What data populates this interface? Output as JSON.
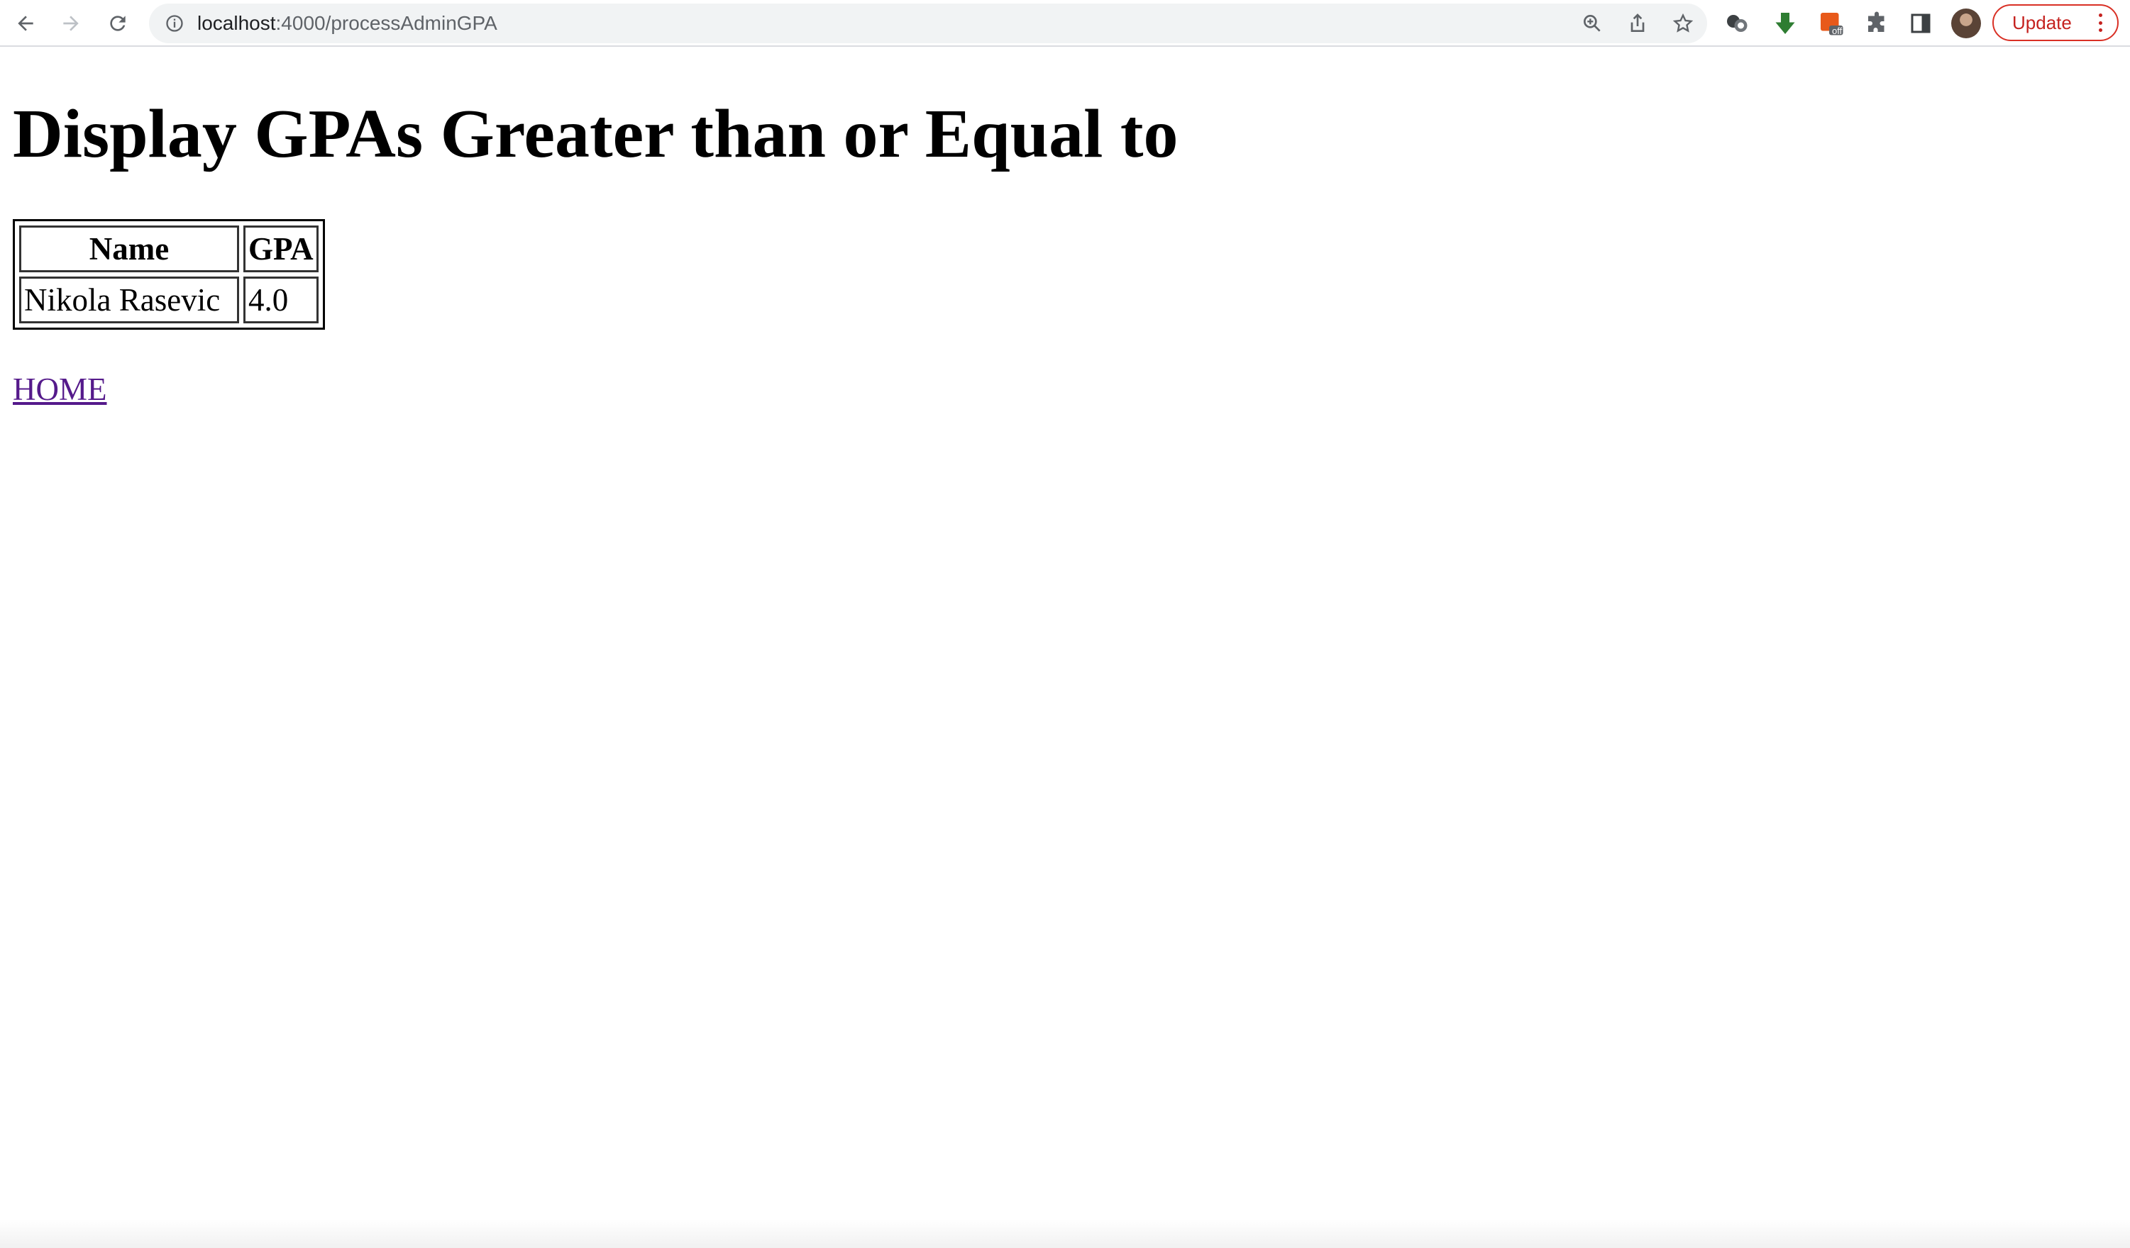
{
  "browser": {
    "url_host": "localhost",
    "url_path": ":4000/processAdminGPA",
    "update_label": "Update",
    "extension_badge": "off",
    "icons": {
      "back": "arrow-left-icon",
      "forward": "arrow-right-icon",
      "reload": "reload-icon",
      "info": "info-icon",
      "zoom": "zoom-icon",
      "share": "share-icon",
      "bookmark": "star-icon",
      "extension_1": "extension-circles-icon",
      "extension_2": "download-arrow-icon",
      "extension_3": "orange-extension-icon",
      "extensions": "puzzle-icon",
      "side_panel": "side-panel-icon",
      "menu": "more-vertical-icon"
    },
    "colors": {
      "update_accent": "#d93025",
      "download_green": "#2e7d32",
      "link_visited": "#551a8b"
    }
  },
  "page": {
    "heading": "Display GPAs Greater than or Equal to",
    "table": {
      "headers": [
        "Name",
        "GPA"
      ],
      "rows": [
        [
          "Nikola Rasevic",
          "4.0"
        ]
      ]
    },
    "home_link": "HOME"
  }
}
